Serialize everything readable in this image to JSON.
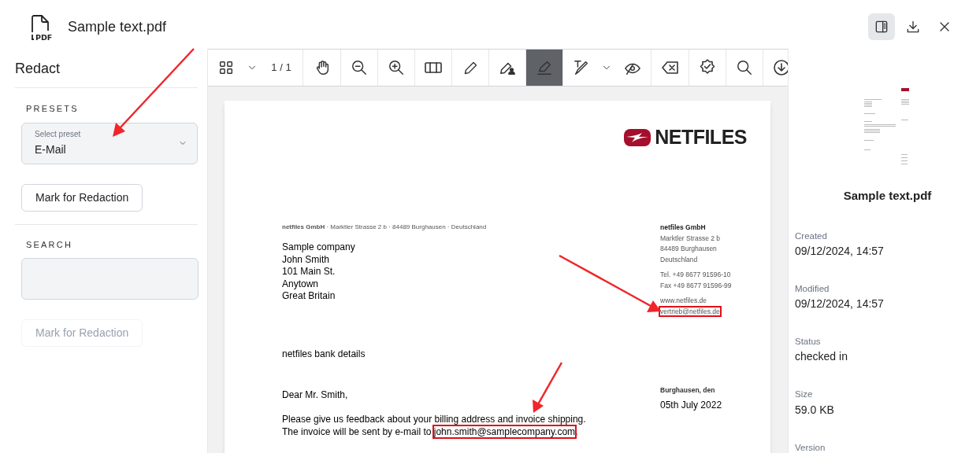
{
  "header": {
    "icon_label": "PDF",
    "file_name": "Sample text.pdf"
  },
  "header_actions": [
    {
      "kind": "panel",
      "selected": true
    },
    {
      "kind": "download",
      "selected": false
    },
    {
      "kind": "close",
      "selected": false
    }
  ],
  "redact_panel": {
    "title": "Redact",
    "presets": {
      "label": "PRESETS",
      "select_label": "Select preset",
      "value": "E-Mail",
      "button": {
        "label": "Mark for Redaction",
        "disabled": false
      }
    },
    "search": {
      "label": "SEARCH",
      "button": {
        "label": "Mark for Redaction",
        "disabled": true
      }
    }
  },
  "toolbar": [
    {
      "kind": "grid",
      "selected": false
    },
    {
      "kind": "caret",
      "selected": false
    },
    {
      "kind": "page",
      "text": "1 / 1"
    },
    {
      "kind": "hand",
      "selected": false
    },
    {
      "kind": "zoom-out",
      "selected": false
    },
    {
      "kind": "zoom-in",
      "selected": false
    },
    {
      "kind": "columns",
      "selected": false
    },
    {
      "kind": "pencil",
      "selected": false
    },
    {
      "kind": "pencil-user",
      "selected": false
    },
    {
      "kind": "redact-pen",
      "selected": true
    },
    {
      "kind": "text-pen",
      "selected": false
    },
    {
      "kind": "caret",
      "selected": false
    },
    {
      "kind": "eye",
      "selected": false
    },
    {
      "kind": "erase",
      "selected": false
    },
    {
      "kind": "badge",
      "selected": false
    },
    {
      "kind": "search",
      "selected": false
    },
    {
      "kind": "download",
      "selected": false
    }
  ],
  "document": {
    "logo_text": "NETFILES",
    "sender_line": "**netfiles GmbH** · Marktler Strasse 2 b · 84489 Burghausen · Deutschland",
    "recipient": [
      "Sample company",
      "John Smith",
      "101 Main St.",
      "Anytown",
      "Great Britain"
    ],
    "company_block": [
      [
        {
          "text": "netfiles GmbH",
          "bold": true,
          "marked": false
        },
        {
          "text": "Marktler Strasse 2 b",
          "bold": false,
          "marked": false
        },
        {
          "text": "84489 Burghausen",
          "bold": false,
          "marked": false
        },
        {
          "text": "Deutschland",
          "bold": false,
          "marked": false
        }
      ],
      [
        {
          "text": "Tel. +49 8677 91596-10",
          "bold": false,
          "marked": false
        },
        {
          "text": "Fax +49 8677 91596-99",
          "bold": false,
          "marked": false
        }
      ],
      [
        {
          "text": "www.netfiles.de",
          "bold": false,
          "marked": false
        },
        {
          "text": "vertrieb@netfiles.de",
          "bold": false,
          "marked": true
        }
      ]
    ],
    "bank_heading": "netfiles bank details",
    "place": "Burghausen, den",
    "date": "05th July 2022",
    "salutation": "Dear Mr. Smith,",
    "body": [
      [
        {
          "text": "Please give us feedback about your billing address and invoice shipping.",
          "marked": false
        }
      ],
      [
        {
          "text": "The invoice will be sent by e-mail to ",
          "marked": false
        },
        {
          "text": "john.smith@samplecompany.com",
          "marked": true
        },
        {
          "text": ".",
          "marked": false
        }
      ]
    ]
  },
  "details": {
    "file_name": "Sample text.pdf",
    "properties": [
      {
        "label": "Created",
        "value": "09/12/2024, 14:57"
      },
      {
        "label": "Modified",
        "value": "09/12/2024, 14:57"
      },
      {
        "label": "Status",
        "value": "checked in"
      },
      {
        "label": "Size",
        "value": "59.0 KB"
      },
      {
        "label": "Version"
      }
    ]
  }
}
